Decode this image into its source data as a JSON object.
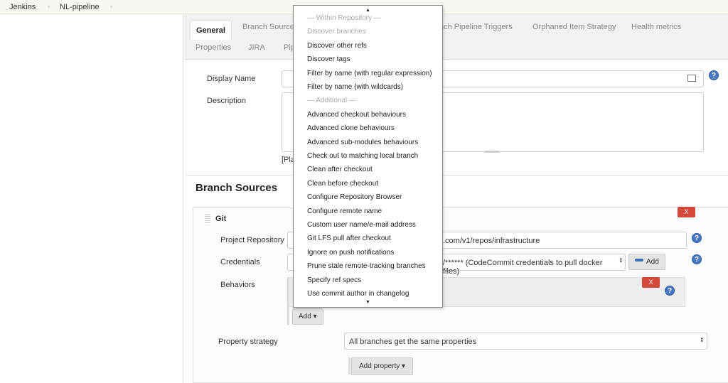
{
  "breadcrumb": [
    "Jenkins",
    "NL-pipeline"
  ],
  "tabs_row1": [
    "General",
    "Branch Sources",
    "nch Pipeline Triggers",
    "Orphaned Item Strategy",
    "Health metrics"
  ],
  "tabs_row2": [
    "Properties",
    "JIRA",
    "Pip"
  ],
  "form": {
    "display_name_label": "Display Name",
    "description_label": "Description",
    "plain_text_hint": "[Pla",
    "branch_sources_title": "Branch Sources",
    "git_title": "Git",
    "project_repository_label": "Project Repository",
    "project_repository_value": ".com/v1/repos/infrastructure",
    "credentials_label": "Credentials",
    "credentials_value": "/****** (CodeCommit credentials to pull docker files)",
    "credentials_add": "Add",
    "behaviors_label": "Behaviors",
    "behaviors_add": "Add",
    "property_strategy_label": "Property strategy",
    "property_strategy_value": "All branches get the same properties",
    "add_property": "Add property",
    "delete_label": "X",
    "help_label": "?"
  },
  "dropdown": {
    "items": [
      {
        "label": "— Within Repository —",
        "disabled": true
      },
      {
        "label": "Discover branches",
        "disabled": true
      },
      {
        "label": "Discover other refs"
      },
      {
        "label": "Discover tags"
      },
      {
        "label": "Filter by name (with regular expression)"
      },
      {
        "label": "Filter by name (with wildcards)"
      },
      {
        "label": "— Additional —",
        "disabled": true
      },
      {
        "label": "Advanced checkout behaviours"
      },
      {
        "label": "Advanced clone behaviours"
      },
      {
        "label": "Advanced sub-modules behaviours"
      },
      {
        "label": "Check out to matching local branch"
      },
      {
        "label": "Clean after checkout"
      },
      {
        "label": "Clean before checkout"
      },
      {
        "label": "Configure Repository Browser"
      },
      {
        "label": "Configure remote name"
      },
      {
        "label": "Custom user name/e-mail address"
      },
      {
        "label": "Git LFS pull after checkout"
      },
      {
        "label": "Ignore on push notifications"
      },
      {
        "label": "Prune stale remote-tracking branches"
      },
      {
        "label": "Specify ref specs"
      },
      {
        "label": "Use commit author in changelog"
      }
    ]
  },
  "colors": {
    "delete": "#d24939",
    "help": "#4a78c2"
  }
}
